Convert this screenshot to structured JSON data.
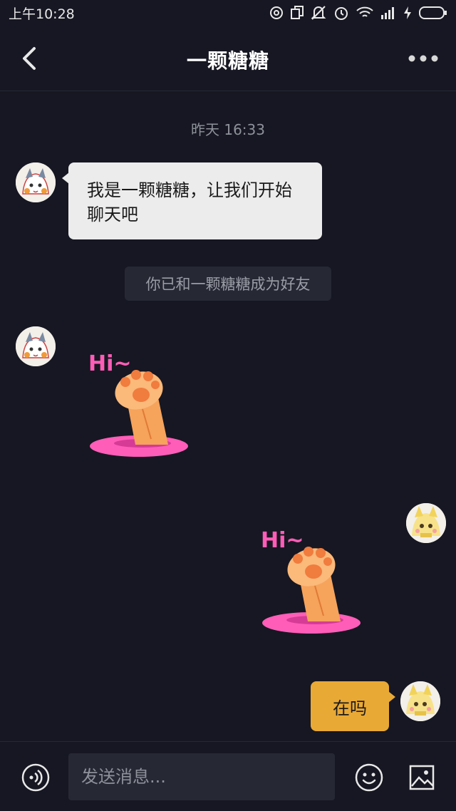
{
  "status_bar": {
    "time": "上午10:28",
    "icons": [
      "hotspot-icon",
      "copy-icon",
      "mute-icon",
      "alarm-icon",
      "wifi-icon",
      "signal-icon",
      "charging-icon",
      "battery-icon"
    ]
  },
  "header": {
    "title": "一颗糖糖",
    "back_icon": "chevron-left-icon",
    "more_icon": "more-dots-icon"
  },
  "messages": {
    "timestamp": "昨天 16:33",
    "incoming_text": "我是一颗糖糖，让我们开始聊天吧",
    "system_note": "你已和一颗糖糖成为好友",
    "sticker_text": "Hi~",
    "outgoing_text": "在吗"
  },
  "input_bar": {
    "placeholder": "发送消息...",
    "voice_icon": "voice-icon",
    "emoji_icon": "emoji-icon",
    "image_icon": "image-icon"
  },
  "colors": {
    "background": "#161722",
    "incoming_bubble": "#ececec",
    "outgoing_bubble": "#e9a935",
    "sticker_pink": "#ff5db8",
    "paw_orange": "#f6a35c"
  }
}
